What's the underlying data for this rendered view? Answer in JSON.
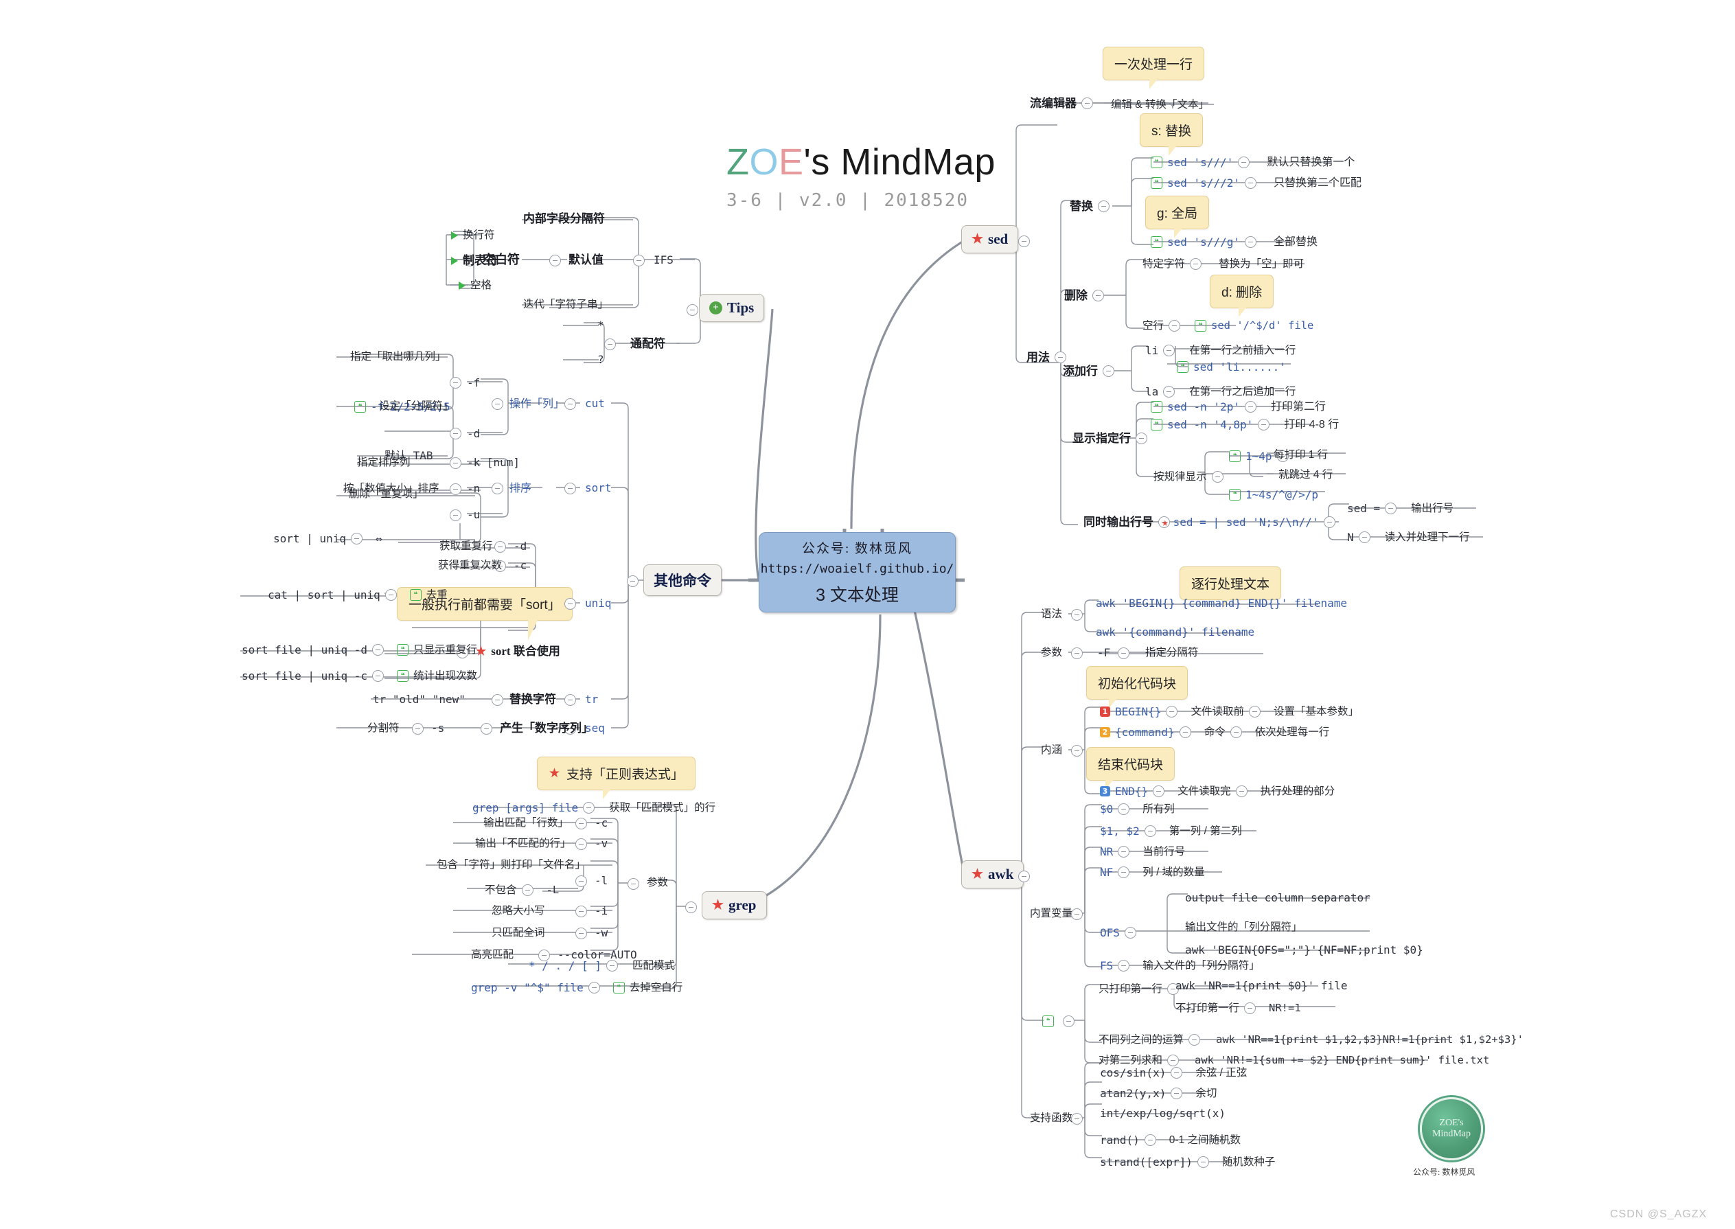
{
  "header": {
    "logo_z": "Z",
    "logo_o": "O",
    "logo_e": "E",
    "logo_rest": "'s MindMap",
    "subtitle": "3-6 | v2.0 | 2018520"
  },
  "central": {
    "line1": "公众号: 数林觅风",
    "line2": "https://woaielf.github.io/",
    "line3": "3 文本处理"
  },
  "branches": {
    "sed": "sed",
    "tips": "Tips",
    "other": "其他命令",
    "grep": "grep",
    "awk": "awk"
  },
  "callouts": {
    "sed_once": "一次处理一行",
    "sed_s": "s: 替换",
    "sed_g": "g: 全局",
    "sed_d": "d: 删除",
    "awk_line": "逐行处理文本",
    "awk_init": "初始化代码块",
    "awk_end": "结束代码块",
    "uniq_sort": "一般执行前都需要「sort」",
    "grep_regex": "支持「正则表达式」"
  },
  "sed": {
    "stream_editor": "流编辑器",
    "edit_convert": "编辑 & 转换「文本」",
    "usage": "用法",
    "replace": "替换",
    "r1": "sed 's///'",
    "r1d": "默认只替换第一个",
    "r2": "sed 's///2'",
    "r2d": "只替换第二个匹配",
    "r3": "sed 's///g'",
    "r3d": "全部替换",
    "delete": "删除",
    "d1": "特定字符",
    "d1d": "替换为「空」即可",
    "d2": "空行",
    "d2d": "sed '/^$/d' file",
    "addline": "添加行",
    "a1": "li",
    "a1d": "在第一行之前插入一行",
    "a1c": "sed 'li......'",
    "a2": "la",
    "a2d": "在第一行之后追加一行",
    "showline": "显示指定行",
    "s1": "sed -n '2p'",
    "s1d": "打印第二行",
    "s2": "sed -n '4,8p'",
    "s2d": "打印 4-8 行",
    "pattern": "按规律显示",
    "p1": "1~4p",
    "p1d1": "每打印 1 行",
    "p1d2": "就跳过 4 行",
    "p2": "1~4s/^@/>/p",
    "lineno": "同时输出行号",
    "lncmd": "sed = | sed 'N;s/\\n//'",
    "ln1": "sed =",
    "ln1d": "输出行号",
    "ln2": "N",
    "ln2d": "读入并处理下一行"
  },
  "tips": {
    "ifs": "IFS",
    "ifs_title": "内部字段分隔符",
    "blank": "空白符",
    "default": "默认值",
    "f1": "换行符",
    "f2": "制表符",
    "f3": "空格",
    "iterate": "迭代「字符子串」",
    "wildcard": "通配符",
    "w1": "*",
    "w2": "?"
  },
  "other": {
    "cut": "cut",
    "cut_d": "操作「列」",
    "cut_f": "-f",
    "cut_f_d": "指定「取出哪几列」",
    "cut_f_c": "-f 2/2-5/2,5",
    "cut_dd": "-d",
    "cut_d_d": "设定「分隔符」",
    "cut_d_c": "默认 TAB",
    "sort": "sort",
    "sort_d": "排序",
    "sort_k": "-k [num]",
    "sort_k_d": "指定排序列",
    "sort_n": "-n",
    "sort_n_d": "按「数值大小」排序",
    "sort_u": "-u",
    "sort_u_d": "删除「重复项」",
    "sort_u_c": "sort | uniq",
    "sort_u_e": "⇔",
    "uniq": "uniq",
    "uniq_d": "-d",
    "uniq_d_d": "获取重复行",
    "uniq_c": "-c",
    "uniq_c_d": "获得重复次数",
    "uniq_sort": "sort 联合使用",
    "u1": "cat | sort | uniq",
    "u1d": "去重",
    "u2": "sort file | uniq -d",
    "u2d": "只显示重复行",
    "u3": "sort file | uniq -c",
    "u3d": "统计出现次数",
    "tr": "tr",
    "tr_d": "替换字符",
    "tr_c": "tr \"old\" \"new\"",
    "seq": "seq",
    "seq_d": "产生「数字序列」",
    "seq_s": "-s",
    "seq_s_d": "分割符"
  },
  "grep": {
    "cmd": "grep [args] file",
    "cmd_d": "获取「匹配模式」的行",
    "args": "参数",
    "g_c": "-c",
    "g_c_d": "输出匹配「行数」",
    "g_v": "-v",
    "g_v_d": "输出「不匹配的行」",
    "g_l": "-l",
    "g_l_d": "包含「字符」则打印「文件名」",
    "g_L": "-L",
    "g_L_d": "不包含",
    "g_i": "-i",
    "g_i_d": "忽略大小写",
    "g_w": "-w",
    "g_w_d": "只匹配全词",
    "g_color": "--color=AUTO",
    "g_color_d": "高亮匹配",
    "pat": "* / . / [ ]",
    "pat_d": "匹配模式",
    "blank": "grep -v \"^$\" file",
    "blank_d": "去掉空白行"
  },
  "awk": {
    "syntax": "语法",
    "syn1": "awk 'BEGIN{} {command} END{}' filename",
    "syn2": "awk '{command}' filename",
    "params": "参数",
    "p_F": "-F",
    "p_F_d": "指定分隔符",
    "meaning": "内涵",
    "m1": "BEGIN{}",
    "m1a": "文件读取前",
    "m1b": "设置「基本参数」",
    "m2": "{command}",
    "m2a": "命令",
    "m2b": "依次处理每一行",
    "m3": "END{}",
    "m3a": "文件读取完",
    "m3b": "执行处理的部分",
    "vars": "内置变量",
    "v0": "$0",
    "v0d": "所有列",
    "v12": "$1, $2",
    "v12d": "第一列 / 第二列",
    "vnr": "NR",
    "vnrd": "当前行号",
    "vnf": "NF",
    "vnfd": "列 / 域的数量",
    "vofs": "OFS",
    "vofs1": "output file column separator",
    "vofs2": "输出文件的「列分隔符」",
    "vofs3": "awk 'BEGIN{OFS=\";\"}'{NF=NF;print $0}",
    "vfs": "FS",
    "vfsd": "输入文件的「列分隔符」",
    "e1": "只打印第一行",
    "e1c": "awk 'NR==1{print $0}' file",
    "e1b": "不打印第一行",
    "e1bc": "NR!=1",
    "e2": "不同列之间的运算",
    "e2c": "awk 'NR==1{print $1,$2,$3}NR!=1{print $1,$2+$3}'",
    "e3": "对第二列求和",
    "e3c": "awk 'NR!=1{sum += $2} END{print sum}' file.txt",
    "funcs": "支持函数",
    "f1": "cos/sin(x)",
    "f1d": "余弦 / 正弦",
    "f2": "atan2(y,x)",
    "f2d": "余切",
    "f3": "int/exp/log/sqrt(x)",
    "f4": "rand()",
    "f4d": "0-1 之间随机数",
    "f5": "strand([expr])",
    "f5d": "随机数种子"
  },
  "watermark": {
    "seal_l1": "ZOE's",
    "seal_l2": "MindMap",
    "caption": "公众号: 数林觅风",
    "csdn": "CSDN @S_AGZX"
  },
  "colors": {
    "central_bg": "#9dbbdf",
    "node_bg": "#f2f1ee",
    "callout_bg": "#fbecc0",
    "code_blue": "#3a5ea8",
    "star_red": "#e2453c",
    "green": "#3cb54a",
    "line": "#8d939c"
  }
}
